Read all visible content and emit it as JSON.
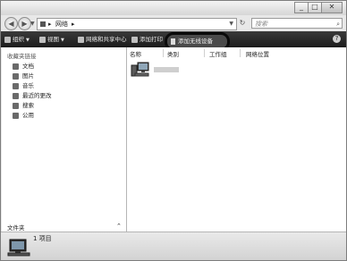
{
  "window": {
    "caption_buttons": [
      "_",
      "□",
      "✕"
    ]
  },
  "address_bar": {
    "back_icon": "back-arrow-icon",
    "forward_icon": "forward-arrow-icon",
    "path": [
      "▸",
      "网络",
      "▸"
    ],
    "refresh_glyph": "↻",
    "search_placeholder": "搜索",
    "search_glyph": "⌕"
  },
  "toolbar": {
    "organize": "组织",
    "views": "视图",
    "network_center": "网络和共享中心",
    "add_printer": "添加打印",
    "add_wireless": "添加无线设备",
    "help_glyph": "?"
  },
  "sidebar": {
    "favorites_title": "收藏夹链接",
    "items": [
      "文档",
      "图片",
      "音乐",
      "最近的更改",
      "搜索",
      "公用"
    ],
    "folders_title": "文件夹",
    "folders_arrow": "⌃"
  },
  "content": {
    "columns": [
      "名称",
      "类别",
      "工作组",
      "网络位置"
    ],
    "items": [
      {
        "name": "",
        "icon": "network-computer-icon"
      }
    ]
  },
  "status_bar": {
    "count": "1 项目"
  },
  "colors": {
    "toolbar_bg": "#2a2a2a",
    "window_frame": "#e8e8e8",
    "highlight_ring": "#0a0a0a"
  }
}
